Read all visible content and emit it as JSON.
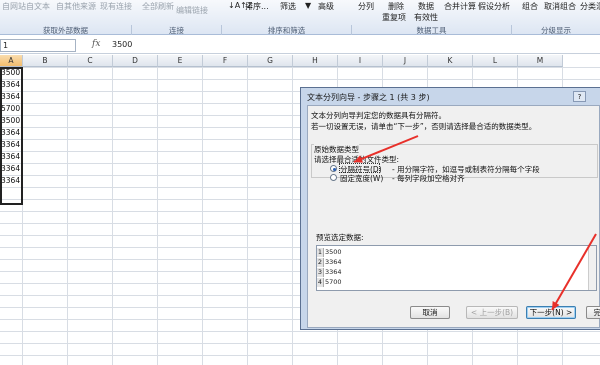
{
  "ribbon": {
    "items": [
      "自网站",
      "自文本",
      "自其他来源",
      "现有连接",
      "全部刷新",
      "编辑链接",
      "排序...",
      "筛选",
      "高级",
      "分列",
      "删除",
      "重复项",
      "数据",
      "有效性",
      "合并计算",
      "假设分析",
      "组合",
      "取消组合",
      "分类汇"
    ],
    "groups": [
      "获取外部数据",
      "连接",
      "排序和筛选",
      "数据工具",
      "分级显示"
    ]
  },
  "formula_bar": {
    "name_box": "1",
    "fx_label": "fx",
    "value": "3500"
  },
  "columns": [
    "A",
    "B",
    "C",
    "D",
    "E",
    "F",
    "G",
    "H",
    "I",
    "J",
    "K",
    "L",
    "M"
  ],
  "column_a_values": [
    "3500",
    "3364",
    "3364",
    "5700",
    "3500",
    "3364",
    "3364",
    "3364",
    "3364",
    "3364"
  ],
  "dialog": {
    "title": "文本分列向导 - 步骤之 1 (共 3 步)",
    "help": "?",
    "line1": "文本分列向导判定您的数据具有分隔符。",
    "line2": "若一切设置无误，请单击“下一步”，否则请选择最合适的数据类型。",
    "section_label": "原始数据类型",
    "choose_label": "请选择最合适的文件类型:",
    "option_delimited": "分隔符号(D)",
    "option_delimited_desc": "- 用分隔字符，如逗号或制表符分隔每个字段",
    "option_fixed": "固定宽度(W)",
    "option_fixed_desc": "- 每列字段加空格对齐",
    "preview_label": "预览选定数据:",
    "preview_rows": [
      {
        "num": "1",
        "value": "3500"
      },
      {
        "num": "2",
        "value": "3364"
      },
      {
        "num": "3",
        "value": "3364"
      },
      {
        "num": "4",
        "value": "5700"
      }
    ],
    "buttons": {
      "cancel": "取消",
      "back": "< 上一步(B)",
      "next": "下一步(N) >",
      "finish": "完成"
    }
  },
  "colors": {
    "arrow": "#e8302a",
    "dialog_frame": "#c7d6ea",
    "selection": "#222222"
  }
}
